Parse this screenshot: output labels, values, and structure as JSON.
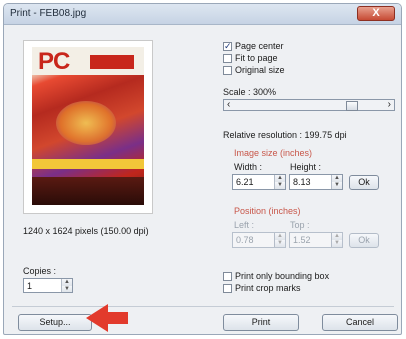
{
  "window": {
    "title": "Print - FEB08.jpg",
    "close_glyph": "X"
  },
  "preview": {
    "cover_logo": "PC",
    "pixel_info": "1240 x 1624 pixels (150.00 dpi)"
  },
  "options": {
    "page_center": {
      "label": "Page center",
      "checked": true,
      "mark": "✓"
    },
    "fit_to_page": {
      "label": "Fit to page",
      "checked": false
    },
    "original_size": {
      "label": "Original size",
      "checked": false
    }
  },
  "scale": {
    "label": "Scale : 300%",
    "left_arrow": "‹",
    "right_arrow": "›",
    "value_percent": 300
  },
  "resolution": {
    "label": "Relative resolution : 199.75 dpi"
  },
  "image_size": {
    "section_label": "Image size (inches)",
    "width_label": "Width :",
    "width_value": "6.21",
    "height_label": "Height :",
    "height_value": "8.13",
    "ok_label": "Ok"
  },
  "position": {
    "section_label": "Position (inches)",
    "left_label": "Left :",
    "left_value": "0.78",
    "top_label": "Top :",
    "top_value": "1.52",
    "ok_label": "Ok"
  },
  "copies": {
    "label": "Copies :",
    "value": "1"
  },
  "print_options": {
    "bounding_box": {
      "label": "Print only bounding box",
      "checked": false
    },
    "crop_marks": {
      "label": "Print crop marks",
      "checked": false
    }
  },
  "buttons": {
    "setup": "Setup...",
    "print": "Print",
    "cancel": "Cancel"
  },
  "colors": {
    "annotation_arrow": "#e23a2c",
    "section_label": "#c8574a"
  },
  "spin": {
    "up": "▲",
    "down": "▼"
  }
}
